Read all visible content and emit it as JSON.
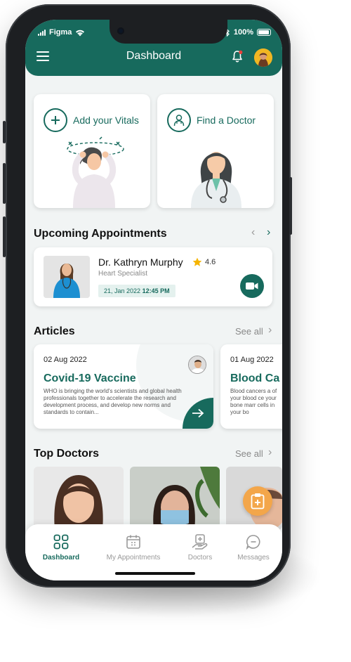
{
  "status_bar": {
    "carrier": "Figma",
    "battery": "100%"
  },
  "header": {
    "title": "Dashboard"
  },
  "quick_actions": [
    {
      "label": "Add your Vitals"
    },
    {
      "label": "Find a Doctor"
    }
  ],
  "appointments": {
    "title": "Upcoming Appointments",
    "item": {
      "doctor": "Dr. Kathryn Murphy",
      "rating": "4.6",
      "specialty": "Heart Specialist",
      "date": "21, Jan 2022",
      "time": "12:45 PM"
    }
  },
  "articles": {
    "title": "Articles",
    "see_all": "See all",
    "items": [
      {
        "date": "02 Aug 2022",
        "title": "Covid-19 Vaccine",
        "text": "WHO is bringing the world's scientists and global health professionals together to accelerate the research and development process, and develop new norms and standards to contain..."
      },
      {
        "date": "01 Aug 2022",
        "title": "Blood Ca",
        "text": "Blood cancers a of your blood ce your bone marr cells in your bo"
      }
    ]
  },
  "top_doctors": {
    "title": "Top Doctors",
    "see_all": "See all"
  },
  "tabs": [
    {
      "label": "Dashboard",
      "active": true
    },
    {
      "label": "My Appointments",
      "active": false
    },
    {
      "label": "Doctors",
      "active": false
    },
    {
      "label": "Messages",
      "active": false
    }
  ],
  "colors": {
    "primary": "#176a5d",
    "accent": "#f3a64a",
    "star": "#f5b400"
  }
}
